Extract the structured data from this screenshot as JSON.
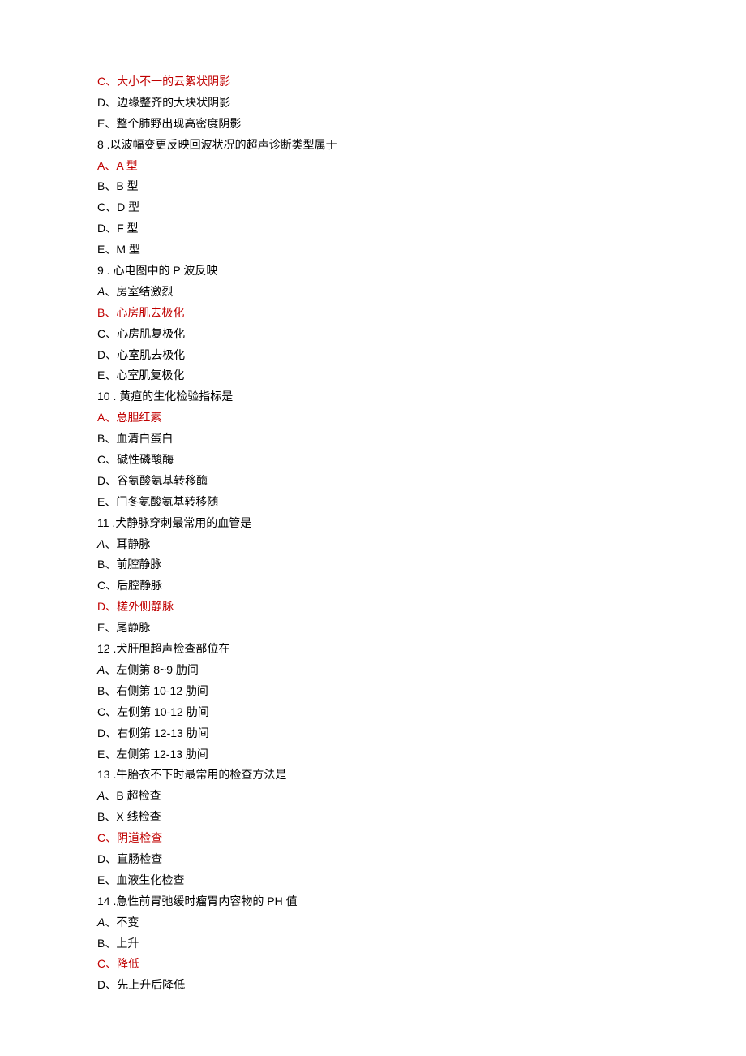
{
  "lines": [
    {
      "text": "C、大小不一的云絮状阴影",
      "highlight": true
    },
    {
      "text": "D、边缘整齐的大块状阴影"
    },
    {
      "text": "E、整个肺野出现高密度阴影"
    },
    {
      "text": "8  .以波幅变更反映回波状况的超声诊断类型属于"
    },
    {
      "text": "A、A 型",
      "highlight": true
    },
    {
      "text": "B、B 型"
    },
    {
      "text": "C、D 型"
    },
    {
      "text": "D、F 型"
    },
    {
      "text": "E、M 型"
    },
    {
      "text": "9  . 心电图中的 P 波反映"
    },
    {
      "prefix": "A",
      "prefixItalic": true,
      "text": "、房室结激烈"
    },
    {
      "text": "B、心房肌去极化",
      "highlight": true
    },
    {
      "text": "C、心房肌复极化"
    },
    {
      "text": "D、心室肌去极化"
    },
    {
      "text": "E、心室肌复极化"
    },
    {
      "text": "10  . 黄疸的生化检验指标是"
    },
    {
      "text": "A、总胆红素",
      "highlight": true
    },
    {
      "text": "B、血清白蛋白"
    },
    {
      "text": "C、碱性磷酸酶"
    },
    {
      "text": "D、谷氨酸氨基转移酶"
    },
    {
      "text": "E、门冬氨酸氨基转移随"
    },
    {
      "text": "11  .犬静脉穿刺最常用的血管是"
    },
    {
      "prefix": "A",
      "prefixItalic": true,
      "text": "、耳静脉"
    },
    {
      "text": "B、前腔静脉"
    },
    {
      "text": "C、后腔静脉"
    },
    {
      "text": "D、槎外侧静脉",
      "highlight": true
    },
    {
      "text": "E、尾静脉"
    },
    {
      "text": "12  .犬肝胆超声检查部位在"
    },
    {
      "prefix": "A",
      "prefixItalic": true,
      "text": "、左侧第 8~9 肋间"
    },
    {
      "text": "B、右侧第 10-12 肋间"
    },
    {
      "text": "C、左侧第 10-12 肋间"
    },
    {
      "text": "D、右侧第 12-13 肋间"
    },
    {
      "text": "E、左侧第 12-13 肋间"
    },
    {
      "text": "13  .牛胎衣不下时最常用的检查方法是"
    },
    {
      "prefix": "A",
      "prefixItalic": true,
      "text": "、B 超检查"
    },
    {
      "text": "B、X 线检查"
    },
    {
      "text": "C、阴道检查",
      "highlight": true
    },
    {
      "text": "D、直肠检查"
    },
    {
      "text": "E、血液生化检查"
    },
    {
      "text": "14  .急性前胃弛缓时瘤胃内容物的 PH 值"
    },
    {
      "prefix": "A",
      "prefixItalic": true,
      "text": "、不变"
    },
    {
      "text": "B、上升"
    },
    {
      "text": "C、降低",
      "highlight": true
    },
    {
      "text": "D、先上升后降低"
    }
  ]
}
